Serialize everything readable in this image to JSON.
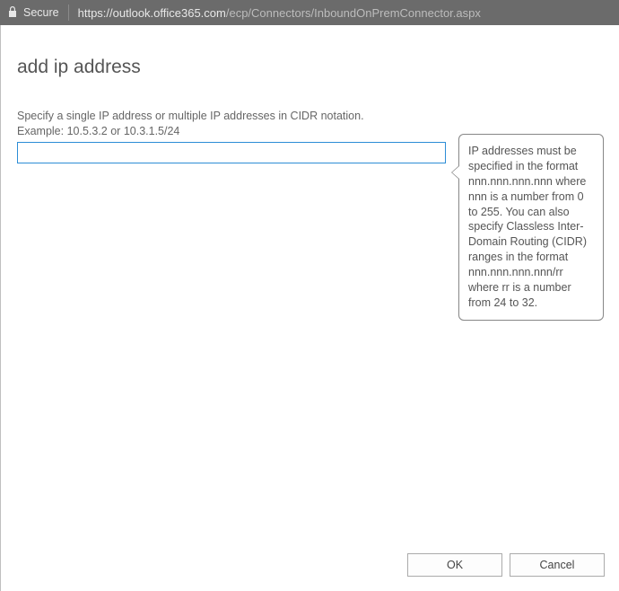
{
  "browser": {
    "secure_label": "Secure",
    "url_host": "https://outlook.office365.com",
    "url_path": "/ecp/Connectors/InboundOnPremConnector.aspx"
  },
  "dialog": {
    "title": "add ip address",
    "instruction": "Specify a single IP address or multiple IP addresses in CIDR notation.",
    "example": "Example: 10.5.3.2 or 10.3.1.5/24",
    "input_value": "",
    "tooltip": "IP addresses must be specified in the format nnn.nnn.nnn.nnn where nnn is a number from 0 to 255. You can also specify Classless Inter-Domain Routing (CIDR) ranges in the format nnn.nnn.nnn.nnn/rr where rr is a number from 24 to 32.",
    "buttons": {
      "ok": "OK",
      "cancel": "Cancel"
    }
  }
}
